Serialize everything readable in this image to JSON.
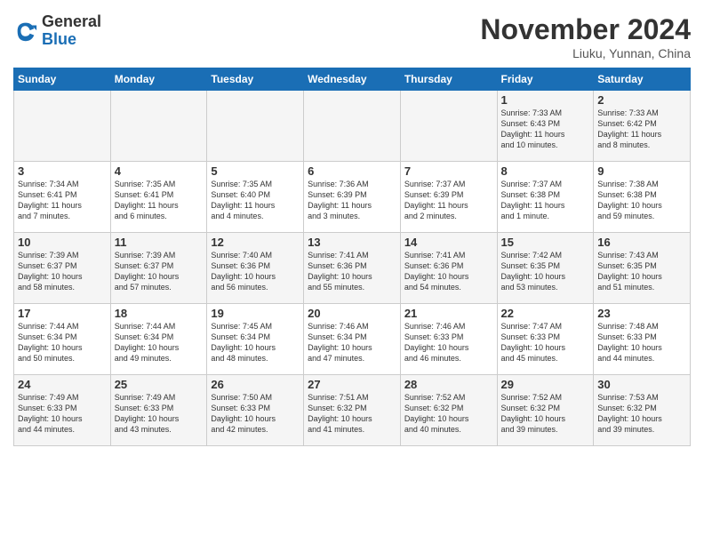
{
  "logo": {
    "general": "General",
    "blue": "Blue"
  },
  "title": "November 2024",
  "location": "Liuku, Yunnan, China",
  "headers": [
    "Sunday",
    "Monday",
    "Tuesday",
    "Wednesday",
    "Thursday",
    "Friday",
    "Saturday"
  ],
  "weeks": [
    [
      {
        "day": "",
        "info": ""
      },
      {
        "day": "",
        "info": ""
      },
      {
        "day": "",
        "info": ""
      },
      {
        "day": "",
        "info": ""
      },
      {
        "day": "",
        "info": ""
      },
      {
        "day": "1",
        "info": "Sunrise: 7:33 AM\nSunset: 6:43 PM\nDaylight: 11 hours\nand 10 minutes."
      },
      {
        "day": "2",
        "info": "Sunrise: 7:33 AM\nSunset: 6:42 PM\nDaylight: 11 hours\nand 8 minutes."
      }
    ],
    [
      {
        "day": "3",
        "info": "Sunrise: 7:34 AM\nSunset: 6:41 PM\nDaylight: 11 hours\nand 7 minutes."
      },
      {
        "day": "4",
        "info": "Sunrise: 7:35 AM\nSunset: 6:41 PM\nDaylight: 11 hours\nand 6 minutes."
      },
      {
        "day": "5",
        "info": "Sunrise: 7:35 AM\nSunset: 6:40 PM\nDaylight: 11 hours\nand 4 minutes."
      },
      {
        "day": "6",
        "info": "Sunrise: 7:36 AM\nSunset: 6:39 PM\nDaylight: 11 hours\nand 3 minutes."
      },
      {
        "day": "7",
        "info": "Sunrise: 7:37 AM\nSunset: 6:39 PM\nDaylight: 11 hours\nand 2 minutes."
      },
      {
        "day": "8",
        "info": "Sunrise: 7:37 AM\nSunset: 6:38 PM\nDaylight: 11 hours\nand 1 minute."
      },
      {
        "day": "9",
        "info": "Sunrise: 7:38 AM\nSunset: 6:38 PM\nDaylight: 10 hours\nand 59 minutes."
      }
    ],
    [
      {
        "day": "10",
        "info": "Sunrise: 7:39 AM\nSunset: 6:37 PM\nDaylight: 10 hours\nand 58 minutes."
      },
      {
        "day": "11",
        "info": "Sunrise: 7:39 AM\nSunset: 6:37 PM\nDaylight: 10 hours\nand 57 minutes."
      },
      {
        "day": "12",
        "info": "Sunrise: 7:40 AM\nSunset: 6:36 PM\nDaylight: 10 hours\nand 56 minutes."
      },
      {
        "day": "13",
        "info": "Sunrise: 7:41 AM\nSunset: 6:36 PM\nDaylight: 10 hours\nand 55 minutes."
      },
      {
        "day": "14",
        "info": "Sunrise: 7:41 AM\nSunset: 6:36 PM\nDaylight: 10 hours\nand 54 minutes."
      },
      {
        "day": "15",
        "info": "Sunrise: 7:42 AM\nSunset: 6:35 PM\nDaylight: 10 hours\nand 53 minutes."
      },
      {
        "day": "16",
        "info": "Sunrise: 7:43 AM\nSunset: 6:35 PM\nDaylight: 10 hours\nand 51 minutes."
      }
    ],
    [
      {
        "day": "17",
        "info": "Sunrise: 7:44 AM\nSunset: 6:34 PM\nDaylight: 10 hours\nand 50 minutes."
      },
      {
        "day": "18",
        "info": "Sunrise: 7:44 AM\nSunset: 6:34 PM\nDaylight: 10 hours\nand 49 minutes."
      },
      {
        "day": "19",
        "info": "Sunrise: 7:45 AM\nSunset: 6:34 PM\nDaylight: 10 hours\nand 48 minutes."
      },
      {
        "day": "20",
        "info": "Sunrise: 7:46 AM\nSunset: 6:34 PM\nDaylight: 10 hours\nand 47 minutes."
      },
      {
        "day": "21",
        "info": "Sunrise: 7:46 AM\nSunset: 6:33 PM\nDaylight: 10 hours\nand 46 minutes."
      },
      {
        "day": "22",
        "info": "Sunrise: 7:47 AM\nSunset: 6:33 PM\nDaylight: 10 hours\nand 45 minutes."
      },
      {
        "day": "23",
        "info": "Sunrise: 7:48 AM\nSunset: 6:33 PM\nDaylight: 10 hours\nand 44 minutes."
      }
    ],
    [
      {
        "day": "24",
        "info": "Sunrise: 7:49 AM\nSunset: 6:33 PM\nDaylight: 10 hours\nand 44 minutes."
      },
      {
        "day": "25",
        "info": "Sunrise: 7:49 AM\nSunset: 6:33 PM\nDaylight: 10 hours\nand 43 minutes."
      },
      {
        "day": "26",
        "info": "Sunrise: 7:50 AM\nSunset: 6:33 PM\nDaylight: 10 hours\nand 42 minutes."
      },
      {
        "day": "27",
        "info": "Sunrise: 7:51 AM\nSunset: 6:32 PM\nDaylight: 10 hours\nand 41 minutes."
      },
      {
        "day": "28",
        "info": "Sunrise: 7:52 AM\nSunset: 6:32 PM\nDaylight: 10 hours\nand 40 minutes."
      },
      {
        "day": "29",
        "info": "Sunrise: 7:52 AM\nSunset: 6:32 PM\nDaylight: 10 hours\nand 39 minutes."
      },
      {
        "day": "30",
        "info": "Sunrise: 7:53 AM\nSunset: 6:32 PM\nDaylight: 10 hours\nand 39 minutes."
      }
    ]
  ]
}
